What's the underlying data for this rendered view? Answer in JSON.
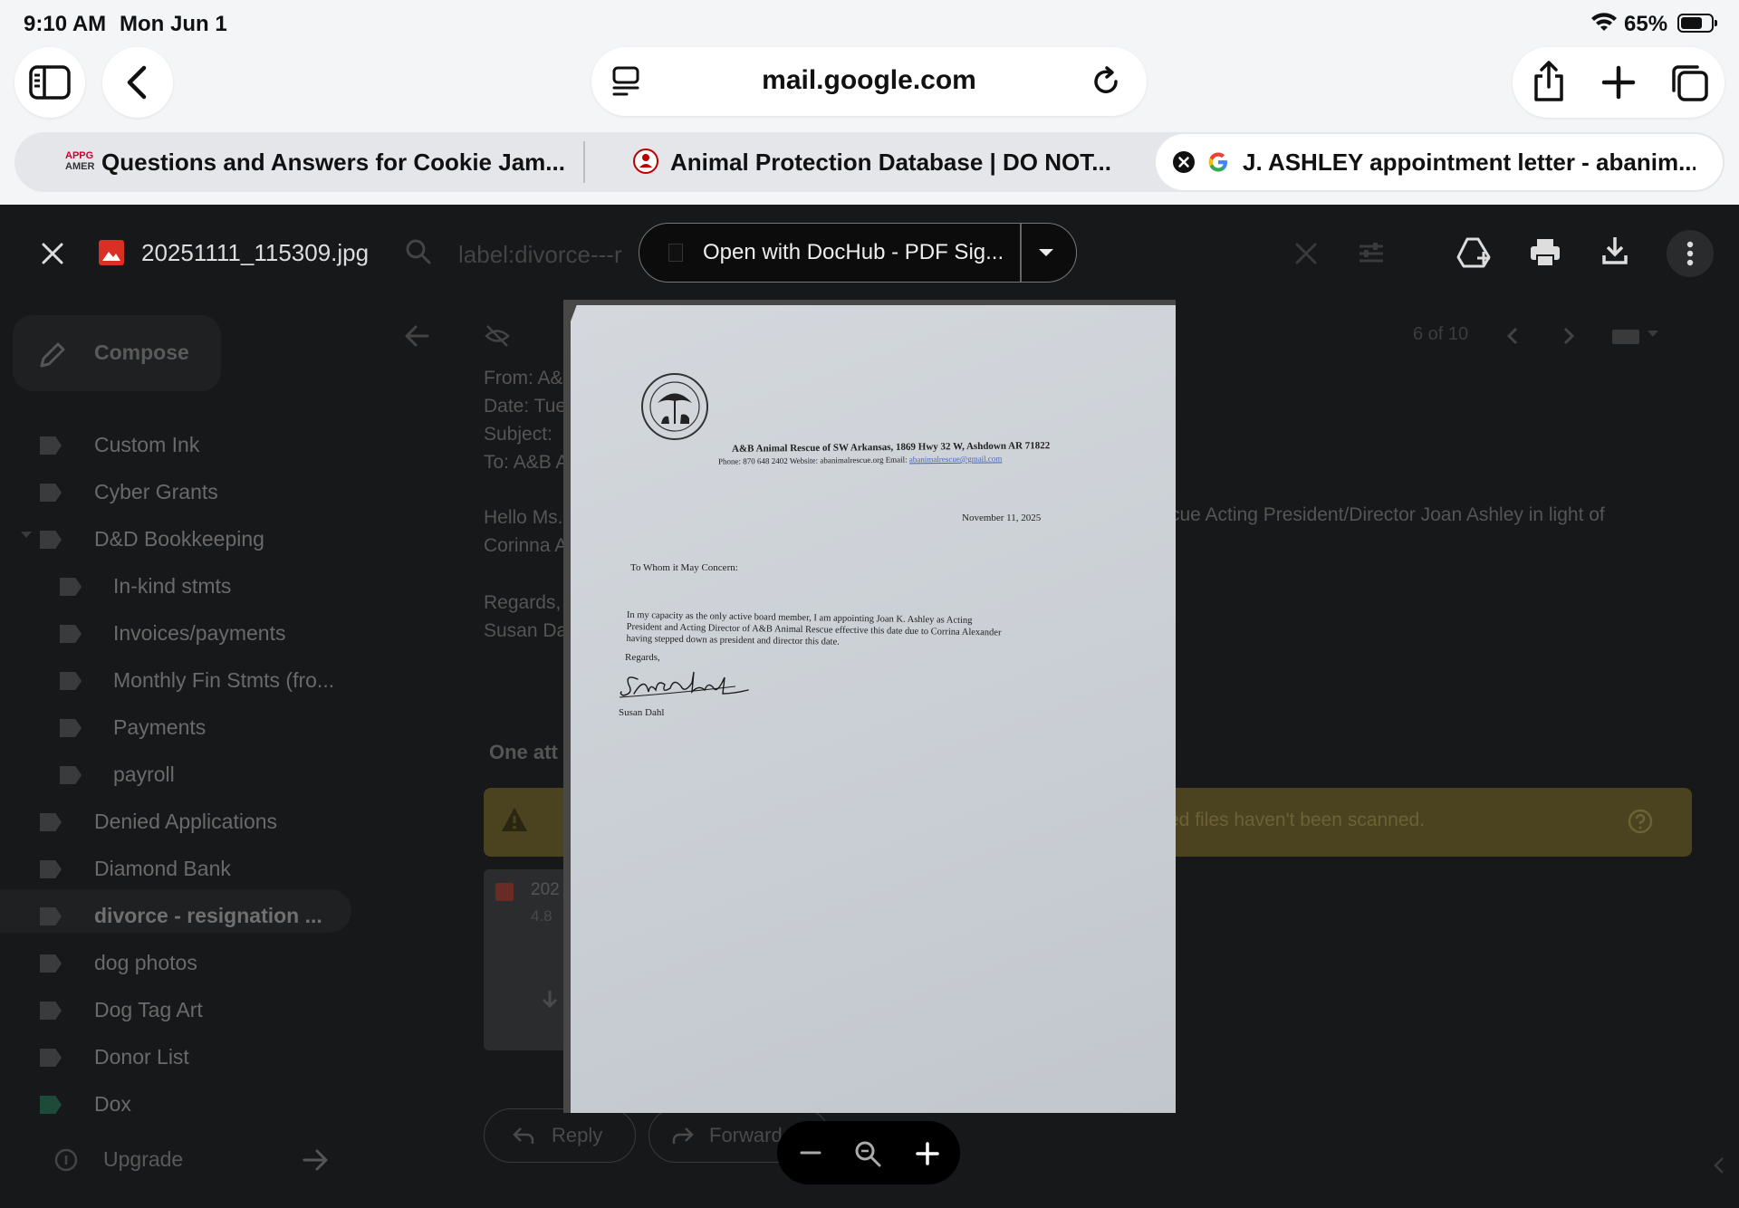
{
  "status": {
    "time": "9:10 AM",
    "date": "Mon Jun 1",
    "battery": "65%"
  },
  "browser": {
    "url": "mail.google.com",
    "tabs": [
      {
        "label": "Questions and Answers for Cookie Jam..."
      },
      {
        "label": "Animal Protection Database | DO NOT..."
      },
      {
        "label": "J. ASHLEY appointment letter - abanim..."
      }
    ],
    "tab1_favicon_text": [
      "APPG",
      "AMER"
    ]
  },
  "viewer": {
    "filename": "20251111_115309.jpg",
    "open_with": "Open with DocHub - PDF Sig..."
  },
  "gmail": {
    "search_text": "label:divorce---r",
    "compose": "Compose",
    "labels": [
      {
        "name": "Custom Ink"
      },
      {
        "name": "Cyber Grants"
      },
      {
        "name": "D&D Bookkeeping"
      },
      {
        "name": "In-kind stmts"
      },
      {
        "name": "Invoices/payments"
      },
      {
        "name": "Monthly Fin Stmts (fro..."
      },
      {
        "name": "Payments"
      },
      {
        "name": "payroll"
      },
      {
        "name": "Denied Applications"
      },
      {
        "name": "Diamond Bank"
      },
      {
        "name": "divorce - resignation ..."
      },
      {
        "name": "dog photos"
      },
      {
        "name": "Dog Tag Art"
      },
      {
        "name": "Donor List"
      },
      {
        "name": "Dox"
      }
    ],
    "upgrade": "Upgrade",
    "pager": "6 of 10",
    "email_meta": [
      "From: A&",
      "Date: Tue",
      "Subject: ",
      "To: A&B A"
    ],
    "body_left": [
      "Hello Ms.",
      "Corinna A"
    ],
    "body_right": "cue Acting President/Director Joan Ashley in light of",
    "regards": [
      "Regards,",
      "Susan Da"
    ],
    "one_attachment": "One att",
    "warning_text": "ed files haven't been scanned.",
    "attachment_name": "202",
    "attachment_size": "4.8",
    "reply": "Reply",
    "forward": "Forward"
  },
  "letter": {
    "org_line": "A&B Animal Rescue of SW Arkansas, 1869 Hwy 32 W, Ashdown AR 71822",
    "contact_line": "Phone: 870 648 2402  Website: abanimalrescue.org  Email:",
    "email": "abanimalrescue@gmail.com",
    "date": "November 11, 2025",
    "salutation": "To Whom it May Concern:",
    "body": [
      "In my capacity as the only active board member, I am appointing Joan K. Ashley as Acting",
      "President and Acting Director of A&B Animal Rescue effective this date due to Corrina Alexander",
      "having stepped down as president and director this date."
    ],
    "closing": "Regards,",
    "signer": "Susan Dahl",
    "seal_text": "A&B ANIMAL RESCUE OF SW ARKANSAS"
  }
}
